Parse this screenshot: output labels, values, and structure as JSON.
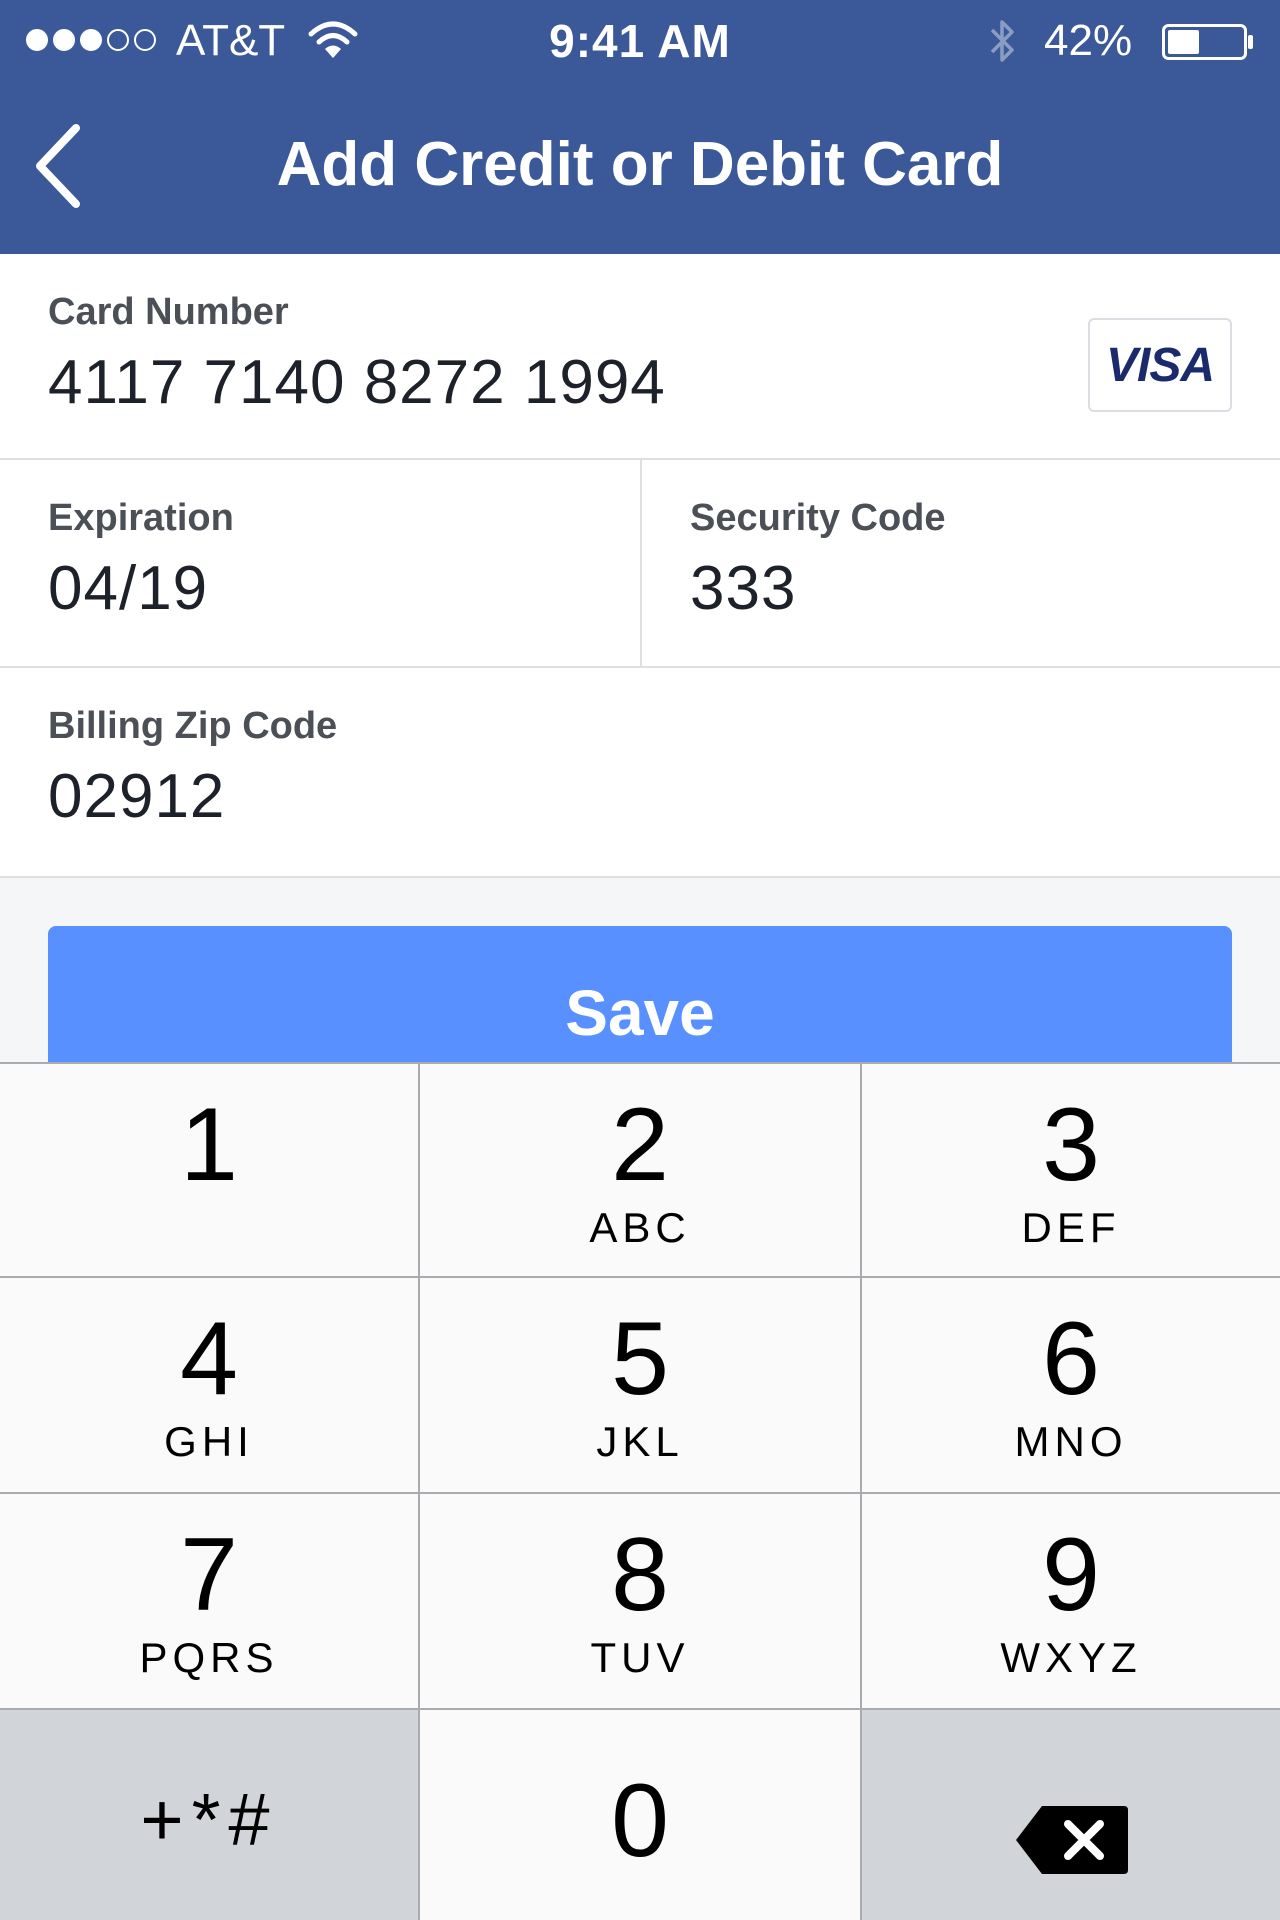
{
  "status_bar": {
    "carrier": "AT&T",
    "time": "9:41 AM",
    "battery_percent": "42%",
    "battery_level": 0.42,
    "signal_bars": 3,
    "signal_total": 5,
    "icons": [
      "wifi-icon",
      "bluetooth-icon",
      "battery-icon"
    ]
  },
  "nav": {
    "title": "Add Credit or Debit Card",
    "back_icon": "chevron-left-icon"
  },
  "form": {
    "card_number": {
      "label": "Card Number",
      "value": "4117 7140 8272 1994",
      "brand": "VISA"
    },
    "expiration": {
      "label": "Expiration",
      "value": "04/19"
    },
    "security_code": {
      "label": "Security Code",
      "value": "333"
    },
    "billing_zip": {
      "label": "Billing Zip Code",
      "value": "02912"
    }
  },
  "save_button": {
    "label": "Save"
  },
  "keypad": {
    "keys": [
      {
        "digit": "1",
        "letters": ""
      },
      {
        "digit": "2",
        "letters": "ABC"
      },
      {
        "digit": "3",
        "letters": "DEF"
      },
      {
        "digit": "4",
        "letters": "GHI"
      },
      {
        "digit": "5",
        "letters": "JKL"
      },
      {
        "digit": "6",
        "letters": "MNO"
      },
      {
        "digit": "7",
        "letters": "PQRS"
      },
      {
        "digit": "8",
        "letters": "TUV"
      },
      {
        "digit": "9",
        "letters": "WXYZ"
      }
    ],
    "symbols": "+*#",
    "zero": "0",
    "delete_icon": "backspace-icon"
  },
  "colors": {
    "header": "#3b5998",
    "save_button": "#5890ff",
    "key": "#fafafa",
    "key_dark": "#d1d4d9"
  }
}
